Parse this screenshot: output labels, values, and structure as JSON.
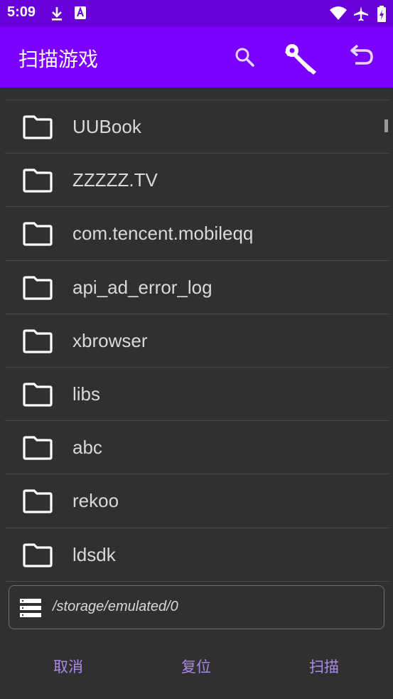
{
  "status_bar": {
    "time": "5:09",
    "icons": [
      "download-icon",
      "a-notification-icon",
      "wifi-icon",
      "airplane-mode-icon",
      "battery-icon"
    ]
  },
  "app_bar": {
    "title": "扫描游戏",
    "actions": [
      "search-icon",
      "wrench-icon",
      "undo-icon"
    ]
  },
  "folders": [
    {
      "name": "UUBook"
    },
    {
      "name": "ZZZZZ.TV"
    },
    {
      "name": "com.tencent.mobileqq"
    },
    {
      "name": "api_ad_error_log"
    },
    {
      "name": "xbrowser"
    },
    {
      "name": "libs"
    },
    {
      "name": "abc"
    },
    {
      "name": "rekoo"
    },
    {
      "name": "ldsdk"
    }
  ],
  "path": {
    "icon": "storage-list-icon",
    "value": "/storage/emulated/0"
  },
  "buttons": {
    "cancel": "取消",
    "reset": "复位",
    "scan": "扫描"
  },
  "colors": {
    "app_bar": "#7b00ff",
    "status_bar": "#6a00d9",
    "background": "#303030",
    "button_text": "#a98ae6"
  }
}
